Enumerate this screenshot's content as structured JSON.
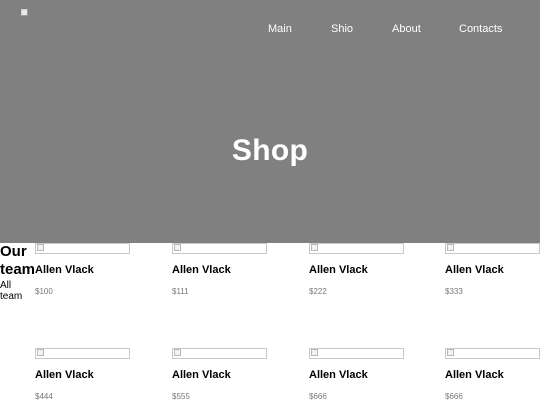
{
  "header": {
    "nav": [
      {
        "label": "Main"
      },
      {
        "label": "Shio"
      },
      {
        "label": "About"
      },
      {
        "label": "Contacts"
      }
    ],
    "title": "Shop"
  },
  "team": {
    "title": "Our team",
    "subtitle": "All team"
  },
  "products": [
    {
      "name": "Allen Vlack",
      "price": "$100"
    },
    {
      "name": "Allen Vlack",
      "price": "$111"
    },
    {
      "name": "Allen Vlack",
      "price": "$222"
    },
    {
      "name": "Allen Vlack",
      "price": "$333"
    },
    {
      "name": "Allen Vlack",
      "price": "$444"
    },
    {
      "name": "Allen Vlack",
      "price": "$555"
    },
    {
      "name": "Allen Vlack",
      "price": "$666"
    },
    {
      "name": "Allen Vlack",
      "price": "$666"
    }
  ]
}
